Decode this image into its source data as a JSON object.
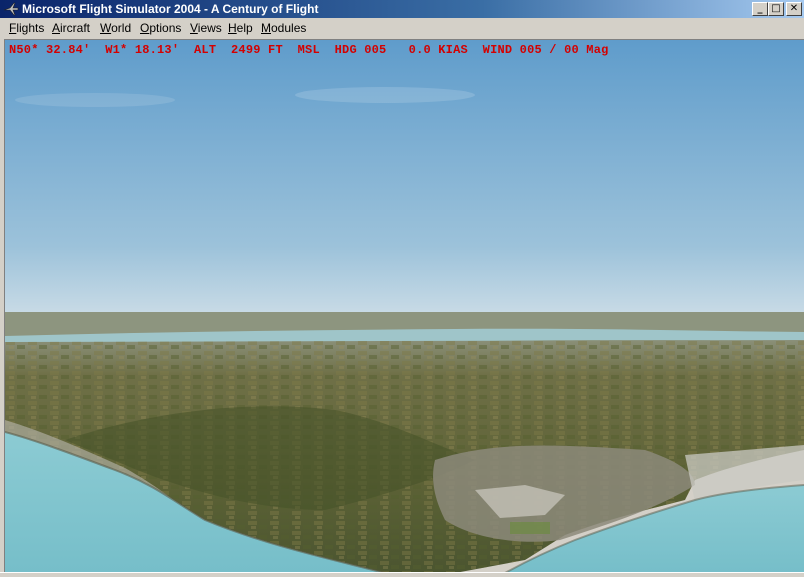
{
  "window": {
    "title": "Microsoft Flight Simulator 2004 - A Century of Flight",
    "controls": {
      "minimize": "_",
      "maximize": "□",
      "close": "✕"
    }
  },
  "menu": [
    {
      "label": "Flights",
      "accel": "F",
      "rest": "lights"
    },
    {
      "label": "Aircraft",
      "accel": "A",
      "rest": "ircraft"
    },
    {
      "label": "World",
      "accel": "W",
      "rest": "orld"
    },
    {
      "label": "Options",
      "accel": "O",
      "rest": "ptions"
    },
    {
      "label": "Views",
      "accel": "V",
      "rest": "iews"
    },
    {
      "label": "Help",
      "accel": "H",
      "rest": "elp"
    },
    {
      "label": "Modules",
      "accel": "M",
      "rest": "odules"
    }
  ],
  "hud": {
    "text": "N50* 32.84'  W1* 18.13'  ALT  2499 FT  MSL  HDG 005   0.0 KIAS  WIND 005 / 00 Mag"
  },
  "colors": {
    "sky_top": "#5f9ccb",
    "sky_horizon": "#c9dbe6",
    "sea": "#7fc3cf",
    "land": "#6b6a3e",
    "hud": "#d40000"
  }
}
